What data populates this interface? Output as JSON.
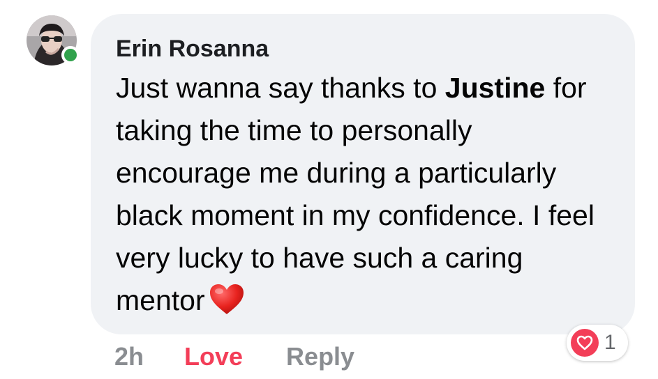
{
  "comment": {
    "author": "Erin Rosanna",
    "online": true,
    "body_part1": "Just wanna say thanks to ",
    "mention": "Justine",
    "body_part2": " for taking the time to personally encourage me during a particularly black moment in my confidence. I feel very lucky to have such a caring mentor",
    "emoji_icon": "red-heart-emoji"
  },
  "actions": {
    "time": "2h",
    "love_label": "Love",
    "reply_label": "Reply"
  },
  "reactions": {
    "icon": "love-reaction-icon",
    "count": "1"
  },
  "colors": {
    "bubble": "#f0f2f5",
    "love": "#f33e58",
    "online": "#31a24c",
    "muted": "#8a8d91"
  }
}
